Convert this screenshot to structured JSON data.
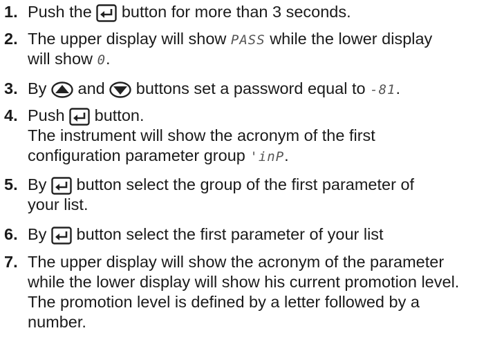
{
  "steps": [
    {
      "num": "1.",
      "a": "Push the",
      "b": "button for more than 3 seconds."
    },
    {
      "num": "2.",
      "a": "The upper display will show",
      "code1": "PASS",
      "b": "while the lower display",
      "c": "will show",
      "code2": "0",
      "d": "."
    },
    {
      "num": "3.",
      "a": "By",
      "b": "and",
      "c": "buttons set a password equal to",
      "code": "-81",
      "d": "."
    },
    {
      "num": "4.",
      "a": "Push",
      "b": "button.",
      "c": "The instrument will show the acronym of the first",
      "d": "configuration parameter group",
      "code": "'inP",
      "e": "."
    },
    {
      "num": "5.",
      "a": "By",
      "b": "button select the group of the first parameter of",
      "c": "your list."
    },
    {
      "num": "6.",
      "a": "By",
      "b": "button select the first parameter of your list"
    },
    {
      "num": "7.",
      "lines": [
        "The upper display will show the acronym of the parameter",
        "while the lower display will show his current promotion level.",
        "The promotion level is defined by a letter followed by a",
        "number."
      ]
    }
  ],
  "icons": {
    "enter": "enter-button-icon",
    "up": "up-arrow-button-icon",
    "down": "down-arrow-button-icon"
  }
}
